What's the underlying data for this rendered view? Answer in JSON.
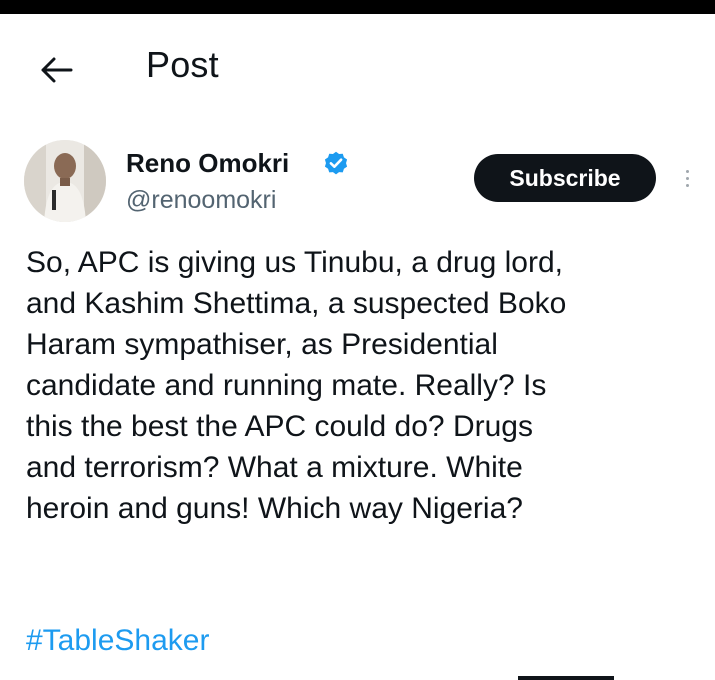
{
  "header": {
    "title": "Post",
    "back_icon": "arrow-left-icon"
  },
  "author": {
    "display_name": "Reno Omokri",
    "handle": "@renoomokri",
    "verified": true,
    "verified_color": "#1d9bf0"
  },
  "actions": {
    "subscribe_label": "Subscribe",
    "more_icon": "more-vertical-icon"
  },
  "post": {
    "lines": [
      "So, APC is giving us Tinubu, a drug lord,",
      "and Kashim Shettima, a suspected Boko",
      "Haram sympathiser, as Presidential",
      "candidate and running mate. Really? Is",
      "this the best the APC could do? Drugs",
      "and terrorism? What a mixture. White",
      "heroin and guns! Which way Nigeria?"
    ],
    "hashtag": "#TableShaker"
  },
  "colors": {
    "text": "#0f1419",
    "secondary": "#536471",
    "link": "#1d9bf0",
    "button_bg": "#0f1419"
  }
}
